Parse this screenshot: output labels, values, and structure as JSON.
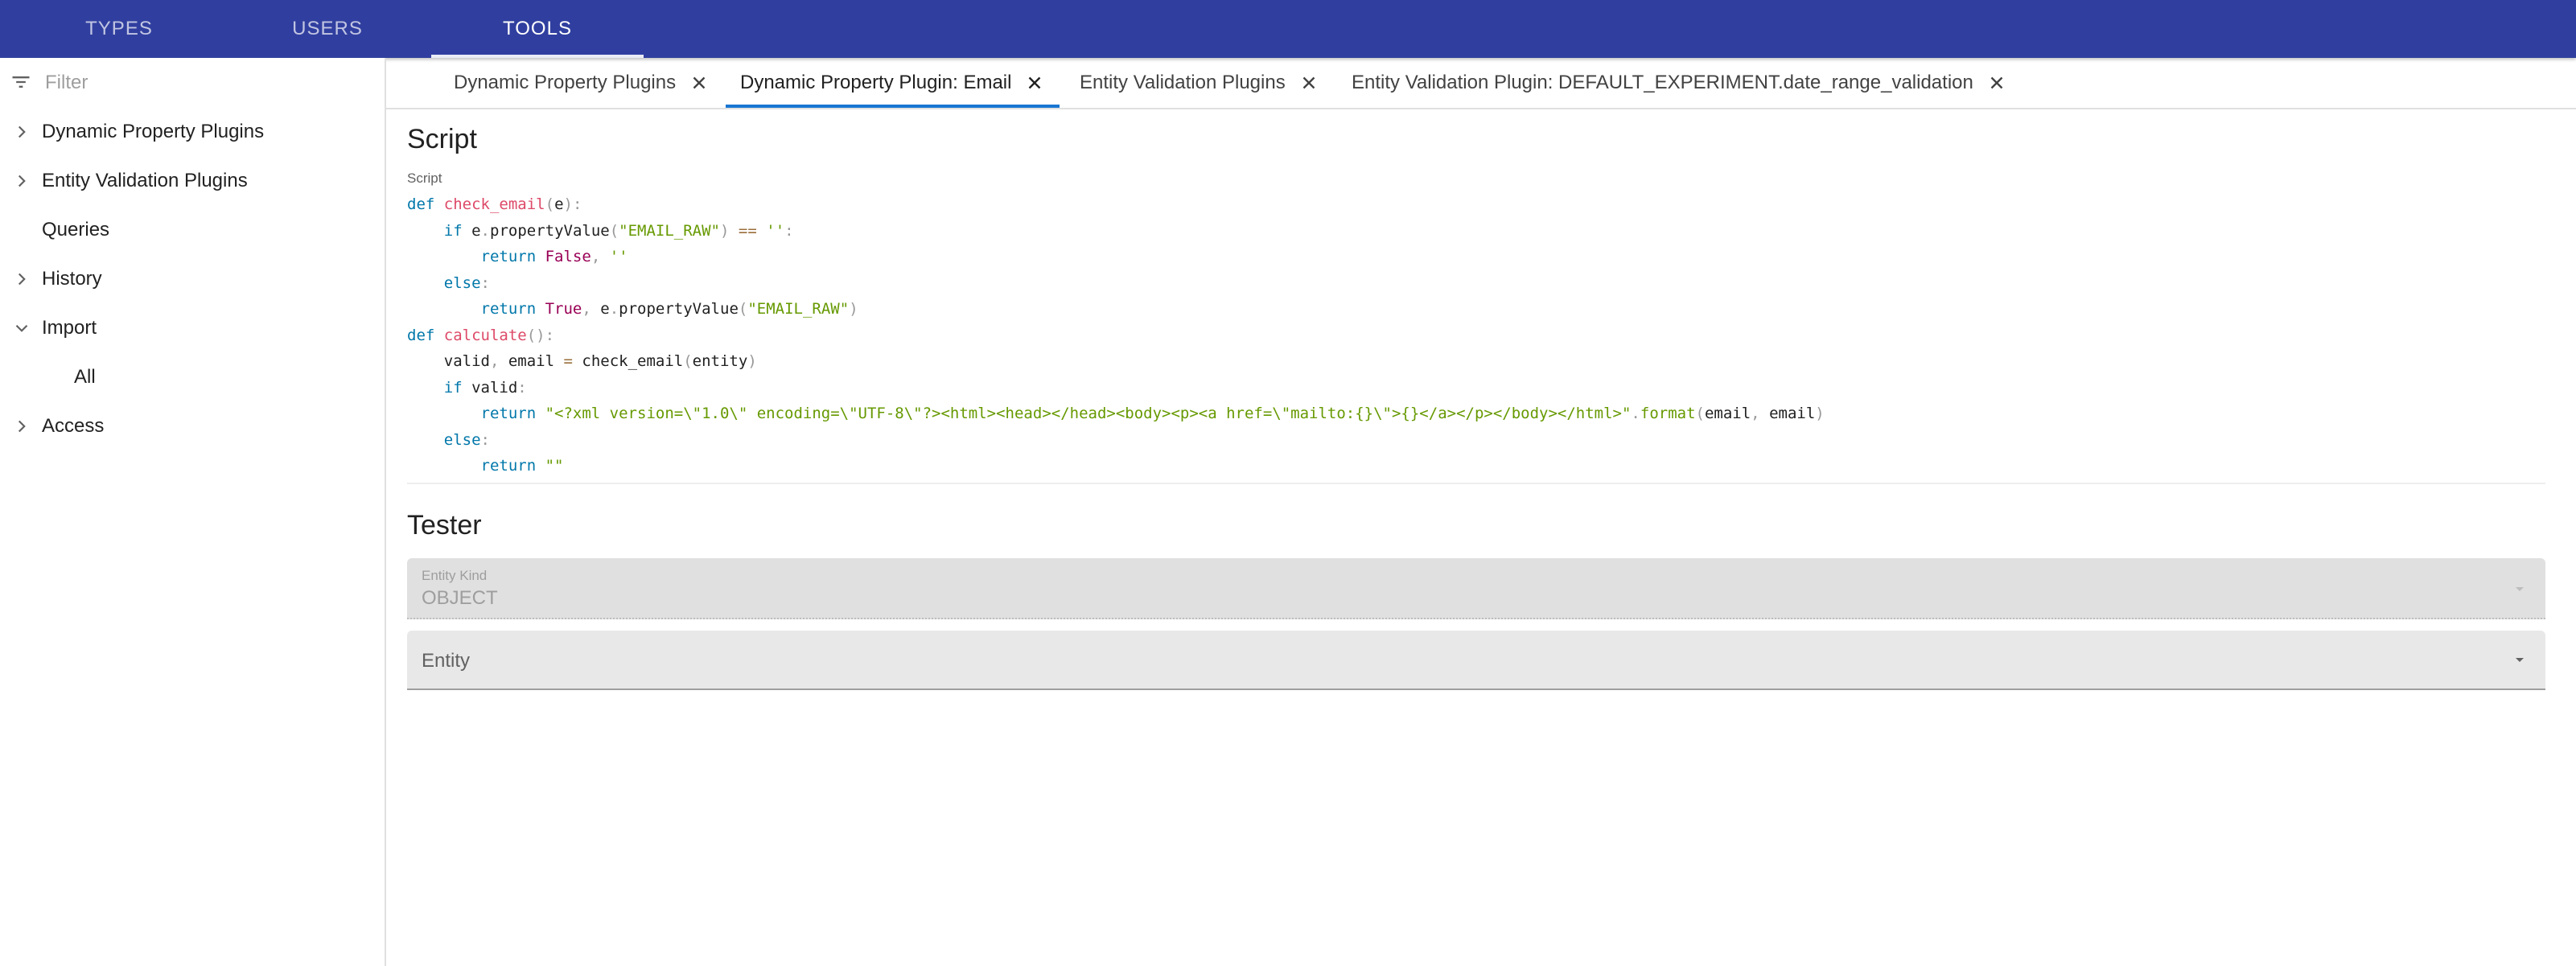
{
  "appbar": {
    "tabs": [
      {
        "label": "TYPES",
        "active": false
      },
      {
        "label": "USERS",
        "active": false
      },
      {
        "label": "TOOLS",
        "active": true
      }
    ]
  },
  "sidebar": {
    "filter_placeholder": "Filter",
    "items": [
      {
        "label": "Dynamic Property Plugins",
        "chevron": "chevron-right-icon"
      },
      {
        "label": "Entity Validation Plugins",
        "chevron": "chevron-right-icon"
      },
      {
        "label": "Queries",
        "chevron": ""
      },
      {
        "label": "History",
        "chevron": "chevron-right-icon"
      },
      {
        "label": "Import",
        "chevron": "chevron-down-icon"
      },
      {
        "label": "All",
        "chevron": ""
      },
      {
        "label": "Access",
        "chevron": "chevron-right-icon"
      }
    ]
  },
  "main": {
    "tabs": [
      {
        "label": "Dynamic Property Plugins",
        "active": false
      },
      {
        "label": "Dynamic Property Plugin: Email",
        "active": true
      },
      {
        "label": "Entity Validation Plugins",
        "active": false
      },
      {
        "label": "Entity Validation Plugin: DEFAULT_EXPERIMENT.date_range_validation",
        "active": false
      }
    ],
    "script": {
      "heading": "Script",
      "field_label": "Script",
      "code": [
        "def check_email(e):",
        "    if e.propertyValue(\"EMAIL_RAW\") == '':",
        "        return False, ''",
        "    else:",
        "        return True, e.propertyValue(\"EMAIL_RAW\")",
        "def calculate():",
        "    valid, email = check_email(entity)",
        "    if valid:",
        "        return \"<?xml version=\\\"1.0\\\" encoding=\\\"UTF-8\\\"?><html><head></head><body><p><a href=\\\"mailto:{}\\\">{}</a></p></body></html>\".format(email, email)",
        "    else:",
        "        return \"\""
      ]
    },
    "tester": {
      "heading": "Tester",
      "entity_kind": {
        "label": "Entity Kind",
        "value": "OBJECT"
      },
      "entity": {
        "placeholder": "Entity"
      }
    }
  },
  "colors": {
    "appbar": "#303f9f",
    "tab_indicator": "#1976d2"
  }
}
